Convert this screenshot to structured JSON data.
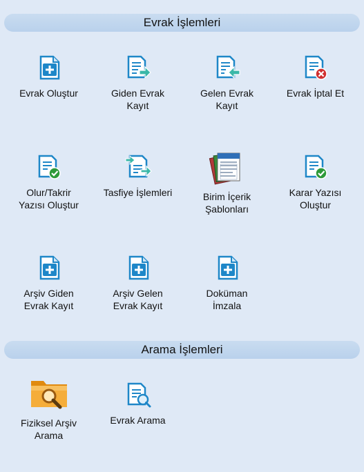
{
  "sections": {
    "evrak": {
      "title": "Evrak İşlemleri"
    },
    "arama": {
      "title": "Arama İşlemleri"
    }
  },
  "evrak_items": [
    {
      "label": "Evrak Oluştur",
      "icon": "document-add-icon"
    },
    {
      "label": "Giden Evrak\nKayıt",
      "icon": "document-outgoing-icon"
    },
    {
      "label": "Gelen Evrak\nKayıt",
      "icon": "document-incoming-icon"
    },
    {
      "label": "Evrak İptal Et",
      "icon": "document-cancel-icon"
    },
    {
      "label": "Olur/Takrir\nYazısı Oluştur",
      "icon": "document-approve-icon"
    },
    {
      "label": "Tasfiye İşlemleri",
      "icon": "document-liquidation-icon"
    },
    {
      "label": "Birim İçerik\nŞablonları",
      "icon": "templates-stack-icon"
    },
    {
      "label": "Karar Yazısı\nOluştur",
      "icon": "document-approve-icon"
    },
    {
      "label": "Arşiv Giden\nEvrak Kayıt",
      "icon": "document-add-icon"
    },
    {
      "label": "Arşiv Gelen\nEvrak Kayıt",
      "icon": "document-add-icon"
    },
    {
      "label": "Doküman\nİmzala",
      "icon": "document-add-icon"
    }
  ],
  "arama_items": [
    {
      "label": "Fiziksel Arşiv\nArama",
      "icon": "folder-search-icon"
    },
    {
      "label": "Evrak Arama",
      "icon": "document-search-icon"
    }
  ],
  "colors": {
    "background": "#dfe9f6",
    "header": "#c4d9ef",
    "icon_blue": "#1e87c8",
    "icon_green": "#2e9a3a",
    "icon_red": "#d03030",
    "folder_orange": "#f0a020"
  }
}
